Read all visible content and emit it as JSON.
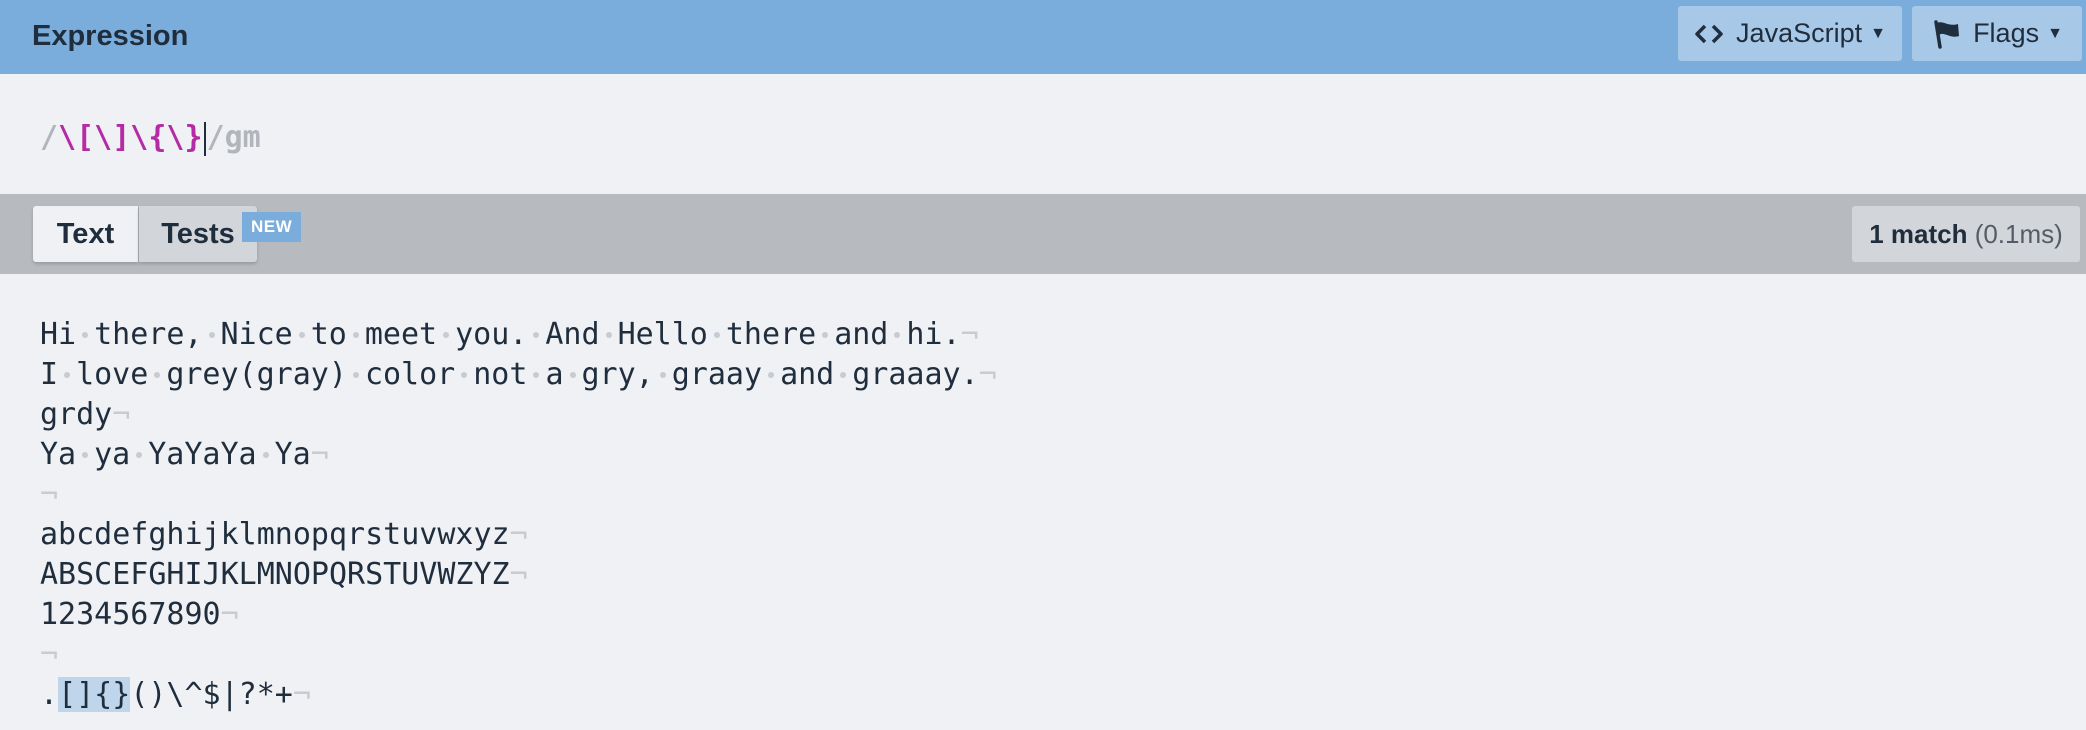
{
  "header": {
    "title": "Expression",
    "language_button": "JavaScript",
    "flags_button": "Flags"
  },
  "expression": {
    "open_delimiter": "/",
    "pattern": "\\[\\]\\{\\}",
    "close_delimiter": "/",
    "flags": "gm"
  },
  "toolbar": {
    "tabs": [
      {
        "label": "Text",
        "active": true
      },
      {
        "label": "Tests",
        "active": false
      }
    ],
    "new_badge": "NEW",
    "match_count": "1 match",
    "match_time": "(0.1ms)"
  },
  "text": {
    "lines": [
      "Hi there, Nice to meet you. And Hello there and hi.",
      "I love grey(gray) color not a gry, graay and graaay.",
      "grdy",
      "Ya ya YaYaYa Ya",
      "",
      "abcdefghijklmnopqrstuvwxyz",
      "ABSCEFGHIJKLMNOPQRSTUVWZYZ",
      "1234567890",
      "",
      ".[]{}()\\^$|?*+"
    ],
    "match": {
      "line": 9,
      "text": "[]{}"
    },
    "newline_symbol": "¬"
  },
  "colors": {
    "header_bg": "#7aaddc",
    "toolbar_bg": "#b7bbc0",
    "pattern": "#b52aa5",
    "highlight": "#bfd5ec"
  },
  "icons": {
    "language": "code-icon",
    "flags": "flag-icon"
  }
}
